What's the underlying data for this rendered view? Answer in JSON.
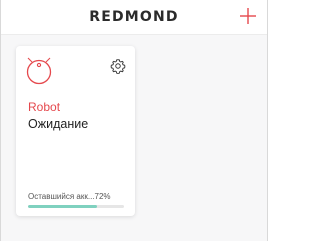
{
  "header": {
    "brand": "REDMOND",
    "add_icon": "plus-icon"
  },
  "colors": {
    "accent": "#e5484d",
    "battery_fill": "#7fd1bf"
  },
  "device_card": {
    "icon": "robot-vacuum-icon",
    "settings_icon": "gear-icon",
    "name": "Robot",
    "status": "Ожидание",
    "battery_label": "Оставшийся акк...72%",
    "battery_level_percent": 72
  }
}
